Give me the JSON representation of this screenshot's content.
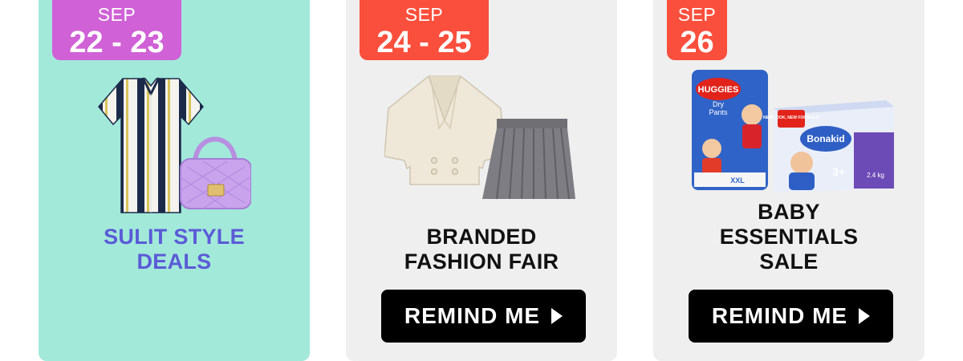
{
  "cards": [
    {
      "date_month": "SEP",
      "date_days": "22 - 23",
      "title_lines": [
        "SULIT STYLE",
        "DEALS"
      ],
      "image_icon": "shirt-and-handbag-image"
    },
    {
      "date_month": "SEP",
      "date_days": "24 - 25",
      "title_lines": [
        "BRANDED",
        "FASHION FAIR"
      ],
      "button_label": "REMIND ME",
      "image_icon": "blazer-and-skirt-image"
    },
    {
      "date_month": "SEP",
      "date_days": "26",
      "title_lines": [
        "BABY",
        "ESSENTIALS",
        "SALE"
      ],
      "button_label": "REMIND ME",
      "image_icon": "diapers-and-milk-image",
      "product_text": {
        "diaper_brand": "HUGGIES",
        "diaper_sub1": "Dry",
        "diaper_sub2": "Pants",
        "diaper_size": "XXL",
        "milk_brand": "Bonakid",
        "milk_badge": "NEW LOOK, NEW FORMULA!",
        "milk_age": "3+",
        "milk_weight": "2.4 kg"
      }
    }
  ],
  "colors": {
    "card1_bg": "#a2e9da",
    "card_bg": "#efefef",
    "badge_purple": "#d061d6",
    "badge_red": "#fa4f3c",
    "title_purple": "#5b5bd6",
    "button_bg": "#000000"
  }
}
